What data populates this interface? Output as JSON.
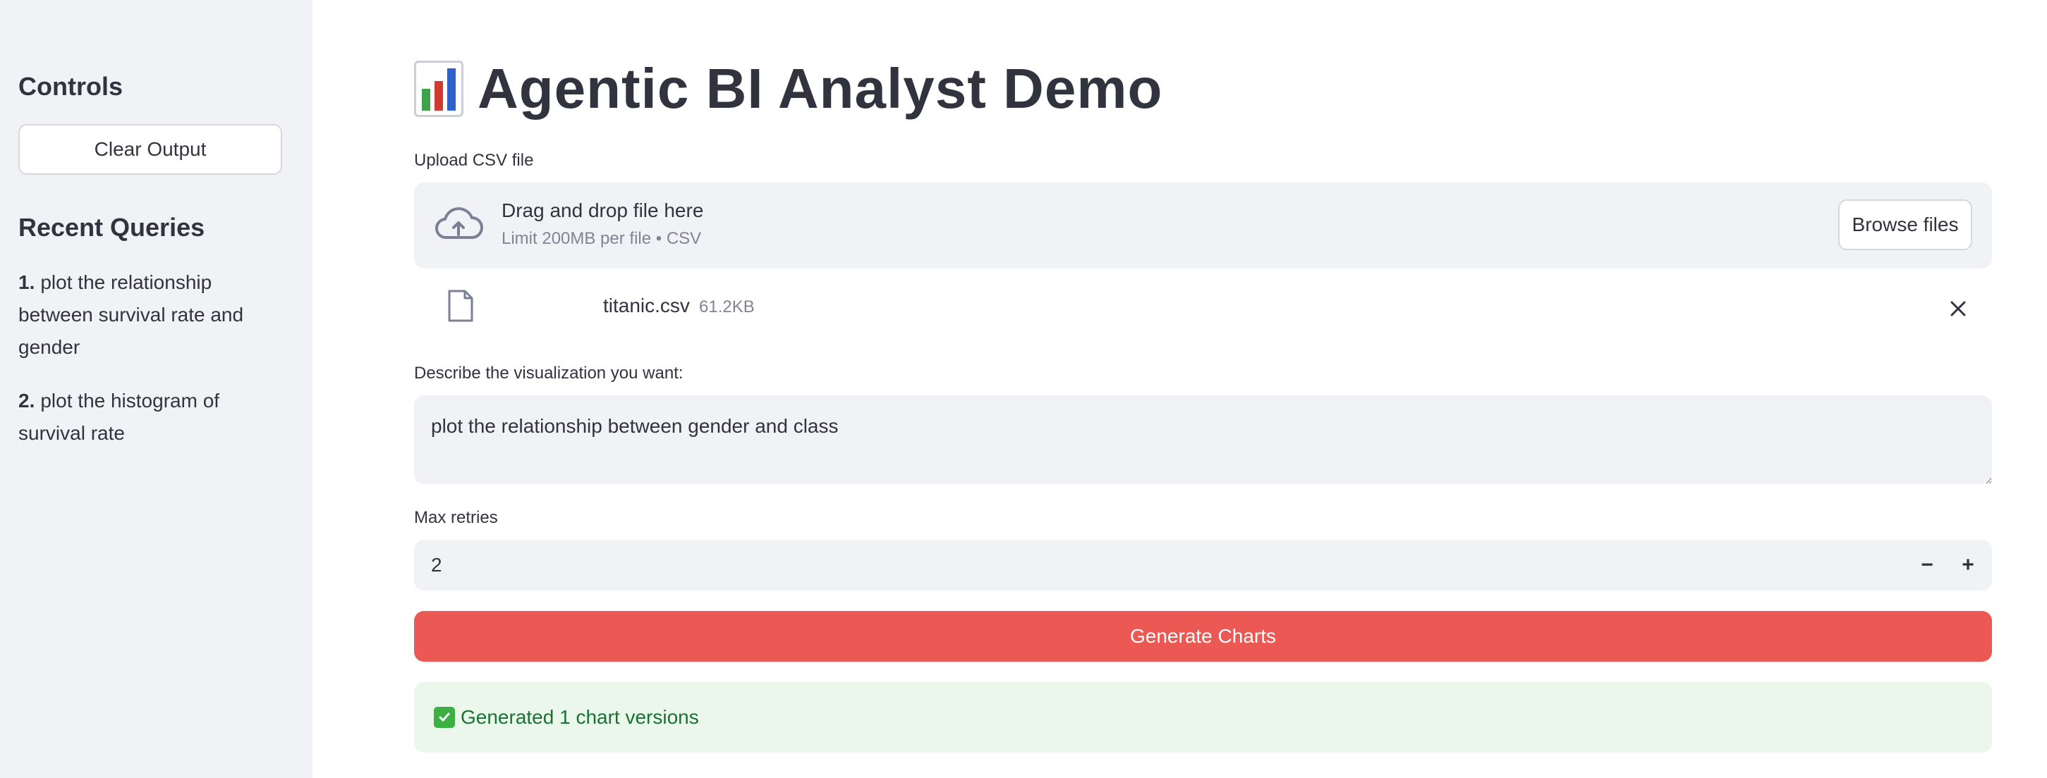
{
  "sidebar": {
    "controls_title": "Controls",
    "clear_button": "Clear Output",
    "recent_title": "Recent Queries",
    "queries": [
      {
        "num": "1.",
        "text": "plot the relationship between survival rate and gender"
      },
      {
        "num": "2.",
        "text": "plot the histogram of survival rate"
      }
    ]
  },
  "main": {
    "page_title": "Agentic BI Analyst Demo",
    "title_icon": "bar-chart-emoji",
    "upload": {
      "label": "Upload CSV file",
      "drag_text": "Drag and drop file here",
      "limit_text": "Limit 200MB per file • CSV",
      "browse_button": "Browse files",
      "icon": "cloud-upload-icon"
    },
    "file": {
      "name": "titanic.csv",
      "size": "61.2KB",
      "icon": "file-icon",
      "remove_icon": "close-icon"
    },
    "prompt": {
      "label": "Describe the visualization you want:",
      "value": "plot the relationship between gender and class"
    },
    "retries": {
      "label": "Max retries",
      "value": "2",
      "minus": "−",
      "plus": "+"
    },
    "generate_button": "Generate Charts",
    "success": {
      "icon": "check-mark-icon",
      "text": "Generated 1 chart versions"
    }
  },
  "colors": {
    "sidebar_bg": "#f0f2f6",
    "primary": "#ec5853",
    "success_bg": "#ecf7ec",
    "success_text": "#177233",
    "text": "#31333f",
    "muted": "#808495"
  }
}
